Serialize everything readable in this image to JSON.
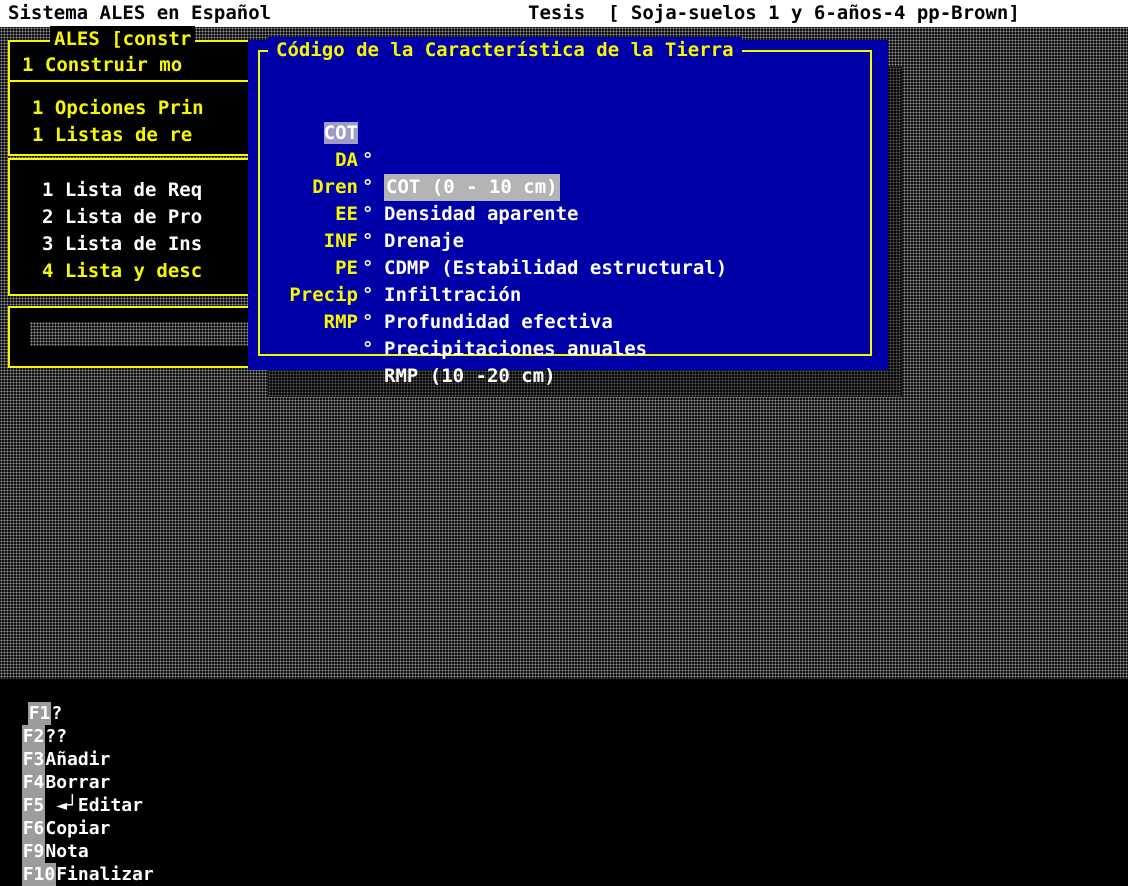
{
  "header": {
    "app_title": "Sistema ALES en Español",
    "mode": "Tesis",
    "project": "[ Soja-suelos 1 y 6-años-4 pp-Brown]"
  },
  "background_menus": {
    "menu1_title": "ALES [constr",
    "menu1_item": "1 Construir mo",
    "menu2_item": "1 Opciones Prin",
    "menu3_item": "1 Listas de re",
    "list_items": [
      "1 Lista de Req",
      "2 Lista de Pro",
      "3 Lista de Ins",
      "4 Lista y desc"
    ]
  },
  "dialog": {
    "title": "Código de la Característica de la Tierra",
    "items": [
      {
        "code": "COT",
        "desc": "COT (0 - 10 cm)",
        "selected": true
      },
      {
        "code": "DA",
        "desc": "Densidad aparente"
      },
      {
        "code": "Dren",
        "desc": "Drenaje"
      },
      {
        "code": "EE",
        "desc": "CDMP (Estabilidad estructural)"
      },
      {
        "code": "INF",
        "desc": "Infiltración"
      },
      {
        "code": "PE",
        "desc": "Profundidad efectiva"
      },
      {
        "code": "Precip",
        "desc": "Precipitaciones anuales"
      },
      {
        "code": "RMP",
        "desc": "RMP (10 -20 cm)"
      }
    ],
    "marker": "°"
  },
  "fkeys": [
    {
      "key": "F1",
      "label": "?"
    },
    {
      "key": "F2",
      "label": "??"
    },
    {
      "key": "F3",
      "label": "Añadir"
    },
    {
      "key": "F4",
      "label": "Borrar"
    },
    {
      "key": "F5",
      "label": " ◄┘Editar"
    },
    {
      "key": "F6",
      "label": "Copiar"
    },
    {
      "key": "F9",
      "label": "Nota"
    },
    {
      "key": "F10",
      "label": "Finalizar"
    }
  ]
}
